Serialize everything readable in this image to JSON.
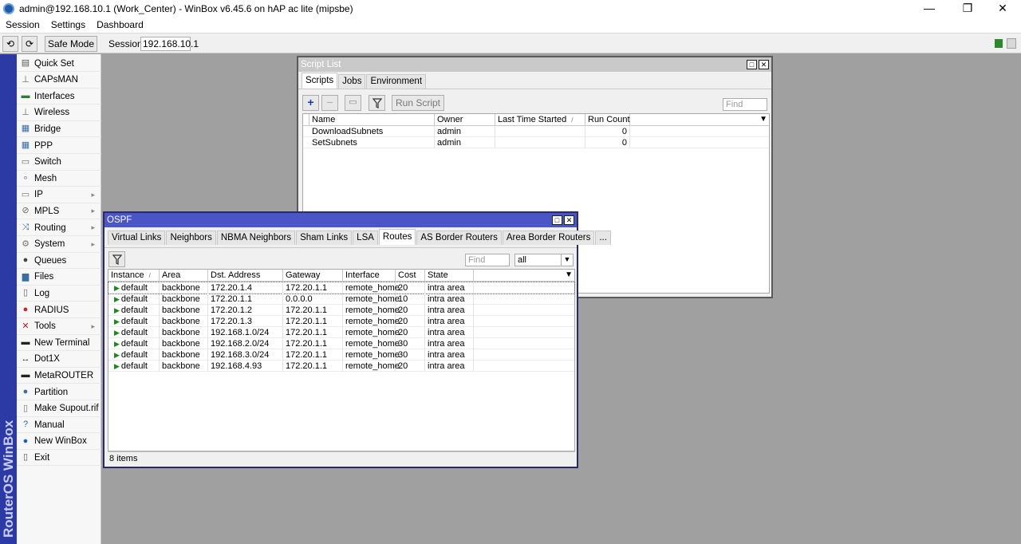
{
  "window": {
    "title": "admin@192.168.10.1 (Work_Center) - WinBox v6.45.6 on hAP ac lite (mipsbe)",
    "minimize": "—",
    "maximize": "❐",
    "close": "✕"
  },
  "menubar": [
    "Session",
    "Settings",
    "Dashboard"
  ],
  "toolbar": {
    "undo": "⟲",
    "redo": "⟳",
    "safe_mode": "Safe Mode",
    "session_label": "Session:",
    "session_value": "192.168.10.1"
  },
  "side_banner": "RouterOS WinBox",
  "side_menu": [
    {
      "label": "Quick Set",
      "icon": "quick-set-icon",
      "submenu": false
    },
    {
      "label": "CAPsMAN",
      "icon": "capsman-icon",
      "submenu": false
    },
    {
      "label": "Interfaces",
      "icon": "interfaces-icon",
      "submenu": false
    },
    {
      "label": "Wireless",
      "icon": "wireless-icon",
      "submenu": false
    },
    {
      "label": "Bridge",
      "icon": "bridge-icon",
      "submenu": false
    },
    {
      "label": "PPP",
      "icon": "ppp-icon",
      "submenu": false
    },
    {
      "label": "Switch",
      "icon": "switch-icon",
      "submenu": false
    },
    {
      "label": "Mesh",
      "icon": "mesh-icon",
      "submenu": false
    },
    {
      "label": "IP",
      "icon": "ip-icon",
      "submenu": true
    },
    {
      "label": "MPLS",
      "icon": "mpls-icon",
      "submenu": true
    },
    {
      "label": "Routing",
      "icon": "routing-icon",
      "submenu": true
    },
    {
      "label": "System",
      "icon": "system-icon",
      "submenu": true
    },
    {
      "label": "Queues",
      "icon": "queues-icon",
      "submenu": false
    },
    {
      "label": "Files",
      "icon": "files-icon",
      "submenu": false
    },
    {
      "label": "Log",
      "icon": "log-icon",
      "submenu": false
    },
    {
      "label": "RADIUS",
      "icon": "radius-icon",
      "submenu": false
    },
    {
      "label": "Tools",
      "icon": "tools-icon",
      "submenu": true
    },
    {
      "label": "New Terminal",
      "icon": "terminal-icon",
      "submenu": false
    },
    {
      "label": "Dot1X",
      "icon": "dot1x-icon",
      "submenu": false
    },
    {
      "label": "MetaROUTER",
      "icon": "metarouter-icon",
      "submenu": false
    },
    {
      "label": "Partition",
      "icon": "partition-icon",
      "submenu": false
    },
    {
      "label": "Make Supout.rif",
      "icon": "supout-icon",
      "submenu": false
    },
    {
      "label": "Manual",
      "icon": "manual-icon",
      "submenu": false
    },
    {
      "label": "New WinBox",
      "icon": "winbox-icon",
      "submenu": false
    },
    {
      "label": "Exit",
      "icon": "exit-icon",
      "submenu": false
    }
  ],
  "script_list": {
    "title": "Script List",
    "tabs": [
      "Scripts",
      "Jobs",
      "Environment"
    ],
    "run_script": "Run Script",
    "find_placeholder": "Find",
    "columns": [
      "Name",
      "Owner",
      "Last Time Started",
      "Run Count"
    ],
    "rows": [
      {
        "name": "DownloadSubnets",
        "owner": "admin",
        "last": "",
        "count": "0"
      },
      {
        "name": "SetSubnets",
        "owner": "admin",
        "last": "",
        "count": "0"
      }
    ]
  },
  "ospf": {
    "title": "OSPF",
    "tabs": [
      "Virtual Links",
      "Neighbors",
      "NBMA Neighbors",
      "Sham Links",
      "LSA",
      "Routes",
      "AS Border Routers",
      "Area Border Routers",
      "..."
    ],
    "find_placeholder": "Find",
    "filter_value": "all",
    "columns": [
      "Instance",
      "Area",
      "Dst. Address",
      "Gateway",
      "Interface",
      "Cost",
      "State"
    ],
    "rows": [
      {
        "instance": "default",
        "area": "backbone",
        "dst": "172.20.1.4",
        "gateway": "172.20.1.1",
        "iface": "remote_home",
        "cost": "20",
        "state": "intra area"
      },
      {
        "instance": "default",
        "area": "backbone",
        "dst": "172.20.1.1",
        "gateway": "0.0.0.0",
        "iface": "remote_home",
        "cost": "10",
        "state": "intra area"
      },
      {
        "instance": "default",
        "area": "backbone",
        "dst": "172.20.1.2",
        "gateway": "172.20.1.1",
        "iface": "remote_home",
        "cost": "20",
        "state": "intra area"
      },
      {
        "instance": "default",
        "area": "backbone",
        "dst": "172.20.1.3",
        "gateway": "172.20.1.1",
        "iface": "remote_home",
        "cost": "20",
        "state": "intra area"
      },
      {
        "instance": "default",
        "area": "backbone",
        "dst": "192.168.1.0/24",
        "gateway": "172.20.1.1",
        "iface": "remote_home",
        "cost": "20",
        "state": "intra area"
      },
      {
        "instance": "default",
        "area": "backbone",
        "dst": "192.168.2.0/24",
        "gateway": "172.20.1.1",
        "iface": "remote_home",
        "cost": "30",
        "state": "intra area"
      },
      {
        "instance": "default",
        "area": "backbone",
        "dst": "192.168.3.0/24",
        "gateway": "172.20.1.1",
        "iface": "remote_home",
        "cost": "30",
        "state": "intra area"
      },
      {
        "instance": "default",
        "area": "backbone",
        "dst": "192.168.4.93",
        "gateway": "172.20.1.1",
        "iface": "remote_home",
        "cost": "20",
        "state": "intra area"
      }
    ],
    "status": "8 items"
  },
  "colors": {
    "banner": "#2b3aa5",
    "active_title": "#4a55c8",
    "inactive_title": "#c9c9c9",
    "route_flag": "#1a8a1a"
  }
}
